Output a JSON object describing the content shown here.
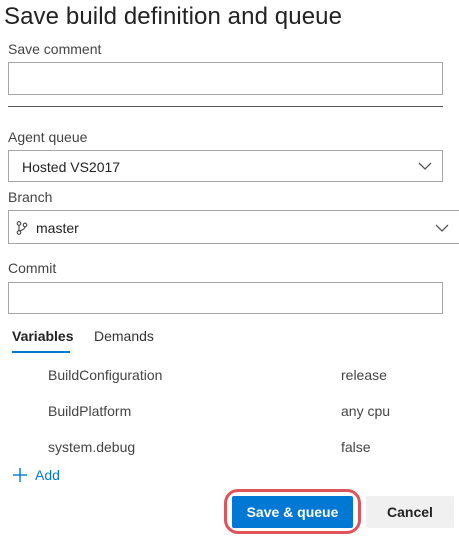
{
  "dialog": {
    "title": "Save build definition and queue"
  },
  "save_comment": {
    "label": "Save comment",
    "value": "",
    "placeholder": ""
  },
  "agent_queue": {
    "label": "Agent queue",
    "selected": "Hosted VS2017"
  },
  "branch": {
    "label": "Branch",
    "selected": "master"
  },
  "commit": {
    "label": "Commit",
    "value": "",
    "placeholder": ""
  },
  "tabs": [
    {
      "label": "Variables",
      "active": true
    },
    {
      "label": "Demands",
      "active": false
    }
  ],
  "variables": [
    {
      "name": "BuildConfiguration",
      "value": "release"
    },
    {
      "name": "BuildPlatform",
      "value": "any cpu"
    },
    {
      "name": "system.debug",
      "value": "false"
    }
  ],
  "add": {
    "label": "Add"
  },
  "buttons": {
    "save_queue": "Save & queue",
    "cancel": "Cancel"
  },
  "colors": {
    "accent": "#0078d4",
    "highlight": "#e0535a"
  }
}
